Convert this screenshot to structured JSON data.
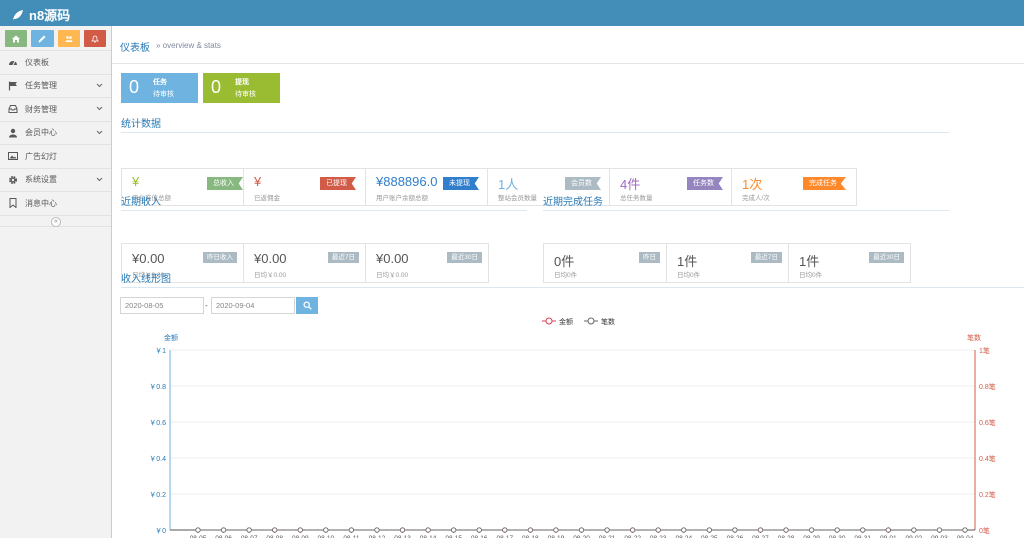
{
  "brand": {
    "name": "n8源码"
  },
  "colors": {
    "primary": "#438eb9",
    "title_blue": "#2679b5",
    "green": "#87b87f",
    "blue": "#6fb3e0",
    "orange": "#ffb752",
    "red": "#d15b47",
    "olive": "#9abc32",
    "purple": "#a069c3",
    "deep_orange": "#ff892a",
    "grey": "#abbac3",
    "tag_blue": "#307ecc",
    "tag_purple": "#9585bf"
  },
  "shortcuts": [
    {
      "icon": "home-icon",
      "color": "#87b87f"
    },
    {
      "icon": "pencil-icon",
      "color": "#6fb3e0"
    },
    {
      "icon": "users-icon",
      "color": "#ffb752"
    },
    {
      "icon": "bell-icon",
      "color": "#d15b47"
    }
  ],
  "sidebar": {
    "items": [
      {
        "label": "仪表板",
        "icon": "dashboard-icon",
        "has_sub": false
      },
      {
        "label": "任务管理",
        "icon": "flag-icon",
        "has_sub": true
      },
      {
        "label": "财务管理",
        "icon": "inbox-icon",
        "has_sub": true
      },
      {
        "label": "会员中心",
        "icon": "user-icon",
        "has_sub": true
      },
      {
        "label": "广告幻灯",
        "icon": "picture-icon",
        "has_sub": false
      },
      {
        "label": "系统设置",
        "icon": "gear-icon",
        "has_sub": true
      },
      {
        "label": "消息中心",
        "icon": "bookmark-icon",
        "has_sub": false
      }
    ],
    "collapse_glyph": "«"
  },
  "breadcrumb": {
    "title": "仪表板",
    "subtitle": "» overview & stats"
  },
  "task_boxes": [
    {
      "num": "0",
      "line1": "任务",
      "line2": "待审核",
      "color": "#6fb3e0"
    },
    {
      "num": "0",
      "line1": "提现",
      "line2": "待审核",
      "color": "#9abc32"
    }
  ],
  "stats": {
    "title": "统计数据",
    "boxes": [
      {
        "value": "¥",
        "label": "平台充值总额",
        "tag": "总收入",
        "color": "#9abc32",
        "tag_color": "#87b87f"
      },
      {
        "value": "¥",
        "label": "已返佣金",
        "tag": "已提现",
        "color": "#d15b47",
        "tag_color": "#d15b47"
      },
      {
        "value": "¥888896.0",
        "label": "用户账户余额总额",
        "tag": "未提现",
        "color": "#307ecc",
        "tag_color": "#307ecc"
      },
      {
        "value": "1人",
        "label": "整站会员数量",
        "tag": "会员数",
        "color": "#6fb3e0",
        "tag_color": "#abbac3"
      },
      {
        "value": "4件",
        "label": "总任务数量",
        "tag": "任务数",
        "color": "#a069c3",
        "tag_color": "#9585bf"
      },
      {
        "value": "1次",
        "label": "完成人/次",
        "tag": "完成任务",
        "color": "#ff892a",
        "tag_color": "#ff892a"
      }
    ]
  },
  "income": {
    "title": "近期收入",
    "boxes": [
      {
        "value": "¥0.00",
        "tag": "昨日收入",
        "avg": "日均￥0.00"
      },
      {
        "value": "¥0.00",
        "tag": "最近7日",
        "avg": "日均￥0.00"
      },
      {
        "value": "¥0.00",
        "tag": "最近30日",
        "avg": "日均￥0.00"
      }
    ]
  },
  "tasks_done": {
    "title": "近期完成任务",
    "boxes": [
      {
        "value": "0件",
        "tag": "昨日",
        "avg": "日均0件"
      },
      {
        "value": "1件",
        "tag": "最近7日",
        "avg": "日均0件"
      },
      {
        "value": "1件",
        "tag": "最近30日",
        "avg": "日均0件"
      }
    ]
  },
  "line_chart": {
    "title": "收入线形图"
  },
  "filter": {
    "start_date": "2020-08-05",
    "separator": "-",
    "end_date": "2020-09-04"
  },
  "chart_data": {
    "type": "line",
    "ylabel_left": "金额",
    "ylabel_right": "笔数",
    "y_ticks_left": [
      "￥0",
      "￥0.2",
      "￥0.4",
      "￥0.6",
      "￥0.8",
      "￥1"
    ],
    "y_ticks_right": [
      "0笔",
      "0.2笔",
      "0.4笔",
      "0.6笔",
      "0.8笔",
      "1笔"
    ],
    "ylim": [
      0,
      1
    ],
    "x": [
      "08-05",
      "08-06",
      "08-07",
      "08-08",
      "08-09",
      "08-10",
      "08-11",
      "08-12",
      "08-13",
      "08-14",
      "08-15",
      "08-16",
      "08-17",
      "08-18",
      "08-19",
      "08-20",
      "08-21",
      "08-22",
      "08-23",
      "08-24",
      "08-25",
      "08-26",
      "08-27",
      "08-28",
      "08-29",
      "08-30",
      "08-31",
      "09-01",
      "09-02",
      "09-03",
      "09-04"
    ],
    "series": [
      {
        "name": "金额",
        "color": "#e03a54",
        "values": [
          0,
          0,
          0,
          0,
          0,
          0,
          0,
          0,
          0,
          0,
          0,
          0,
          0,
          0,
          0,
          0,
          0,
          0,
          0,
          0,
          0,
          0,
          0,
          0,
          0,
          0,
          0,
          0,
          0,
          0,
          0
        ]
      },
      {
        "name": "笔数",
        "color": "#666666",
        "values": [
          0,
          0,
          0,
          0,
          0,
          0,
          0,
          0,
          0,
          0,
          0,
          0,
          0,
          0,
          0,
          0,
          0,
          0,
          0,
          0,
          0,
          0,
          0,
          0,
          0,
          0,
          0,
          0,
          0,
          0,
          0
        ]
      }
    ],
    "legend": "top-center",
    "grid": true
  }
}
